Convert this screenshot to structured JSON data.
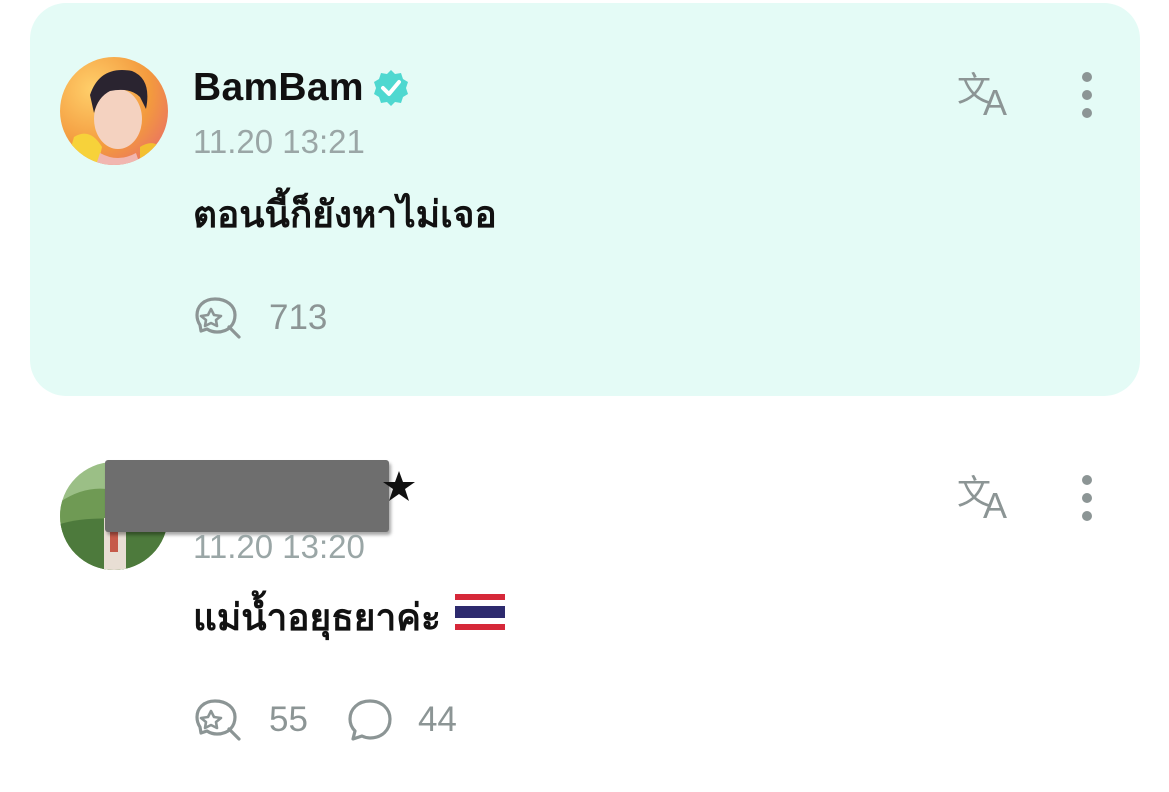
{
  "posts": [
    {
      "username": "BamBam",
      "verified": true,
      "timestamp": "11.20 13:21",
      "body": "ตอนนี้ก็ยังหาไม่เจอ",
      "actions": [
        {
          "icon": "like-bubble-icon",
          "count": "713"
        }
      ],
      "highlight_color": "#e4fbf6"
    },
    {
      "username_redacted": true,
      "timestamp": "11.20 13:20",
      "body": "แม่น้ำอยุธยาค่ะ",
      "body_emoji": "thailand-flag-icon",
      "actions": [
        {
          "icon": "like-bubble-icon",
          "count": "55"
        },
        {
          "icon": "comment-icon",
          "count": "44"
        }
      ]
    }
  ],
  "colors": {
    "verified": "#4fd8d0",
    "muted": "#9aa6a6",
    "icon": "#8c9595"
  }
}
